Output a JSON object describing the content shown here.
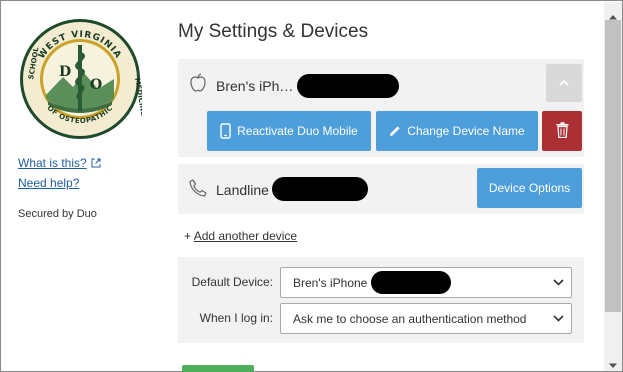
{
  "sidebar": {
    "logo": {
      "text_top": "WEST VIRGINIA",
      "text_left": "SCHOOL",
      "text_right": "MEDICINE",
      "text_bottom": "OF OSTEOPATHIC",
      "letter_left": "D",
      "letter_right": "O",
      "colors": {
        "ring": "#1e4a2c",
        "gold": "#c9a227",
        "ink": "#1a3a24"
      }
    },
    "what_is_this": "What is this?",
    "need_help": "Need help?",
    "secured_by": "Secured by Duo"
  },
  "main": {
    "title": "My Settings & Devices",
    "devices": [
      {
        "icon": "apple-icon",
        "name": "Bren's iPh…",
        "actions": {
          "reactivate": "Reactivate Duo Mobile",
          "change_name": "Change Device Name",
          "delete_icon": "trash-icon"
        }
      },
      {
        "icon": "phone-handset-icon",
        "name": "Landline",
        "options_label": "Device Options"
      }
    ],
    "add_prefix": "+",
    "add_device": "Add another device",
    "default_device": {
      "label": "Default Device:",
      "value": "Bren's iPhone"
    },
    "when_login": {
      "label": "When I log in:",
      "value": "Ask me to choose an authentication method"
    }
  },
  "colors": {
    "primary": "#4d9edb",
    "danger": "#ab3034",
    "success": "#4fae5b",
    "panel": "#f2f2f2",
    "link": "#1f5fa0"
  }
}
